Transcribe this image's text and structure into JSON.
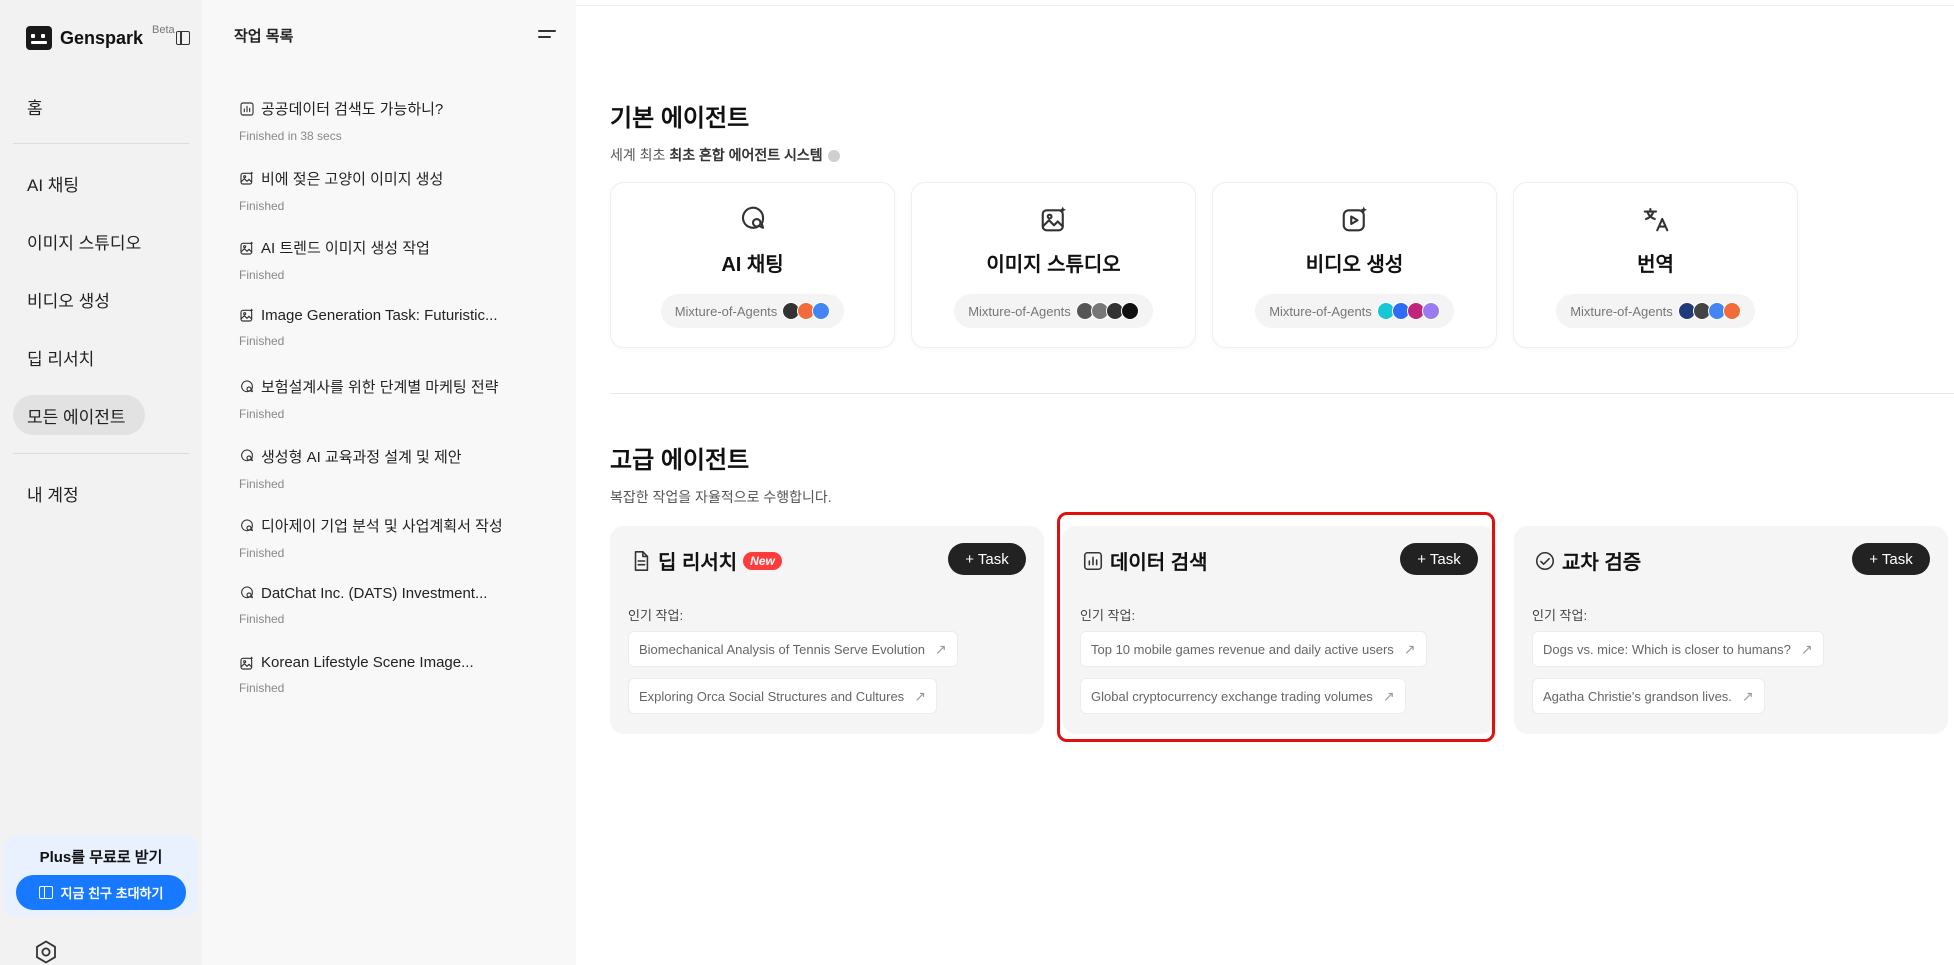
{
  "sidebar": {
    "brand": "Genspark",
    "beta": "Beta",
    "nav": [
      "홈",
      "AI 채팅",
      "이미지 스튜디오",
      "비디오 생성",
      "딥 리서치",
      "모든 에이전트",
      "내 계정"
    ],
    "promo_title": "Plus를 무료로 받기",
    "promo_button": "지금 친구 초대하기"
  },
  "tasks": {
    "title": "작업 목록",
    "items": [
      {
        "title": "공공데이터 검색도 가능하니?",
        "status": "Finished in 38 secs",
        "icon": "data-chart-icon"
      },
      {
        "title": "비에 젖은 고양이 이미지 생성",
        "status": "Finished",
        "icon": "image-icon"
      },
      {
        "title": "AI 트렌드 이미지 생성 작업",
        "status": "Finished",
        "icon": "image-icon"
      },
      {
        "title": "Image Generation Task: Futuristic...",
        "status": "Finished",
        "icon": "image-icon"
      },
      {
        "title": "보험설계사를 위한 단계별 마케팅 전략",
        "status": "Finished",
        "icon": "chat-icon"
      },
      {
        "title": "생성형 AI 교육과정 설계 및 제안",
        "status": "Finished",
        "icon": "chat-icon"
      },
      {
        "title": "디아제이 기업 분석 및 사업계획서 작성",
        "status": "Finished",
        "icon": "chat-icon"
      },
      {
        "title": "DatChat Inc. (DATS) Investment...",
        "status": "Finished",
        "icon": "chat-icon"
      },
      {
        "title": "Korean Lifestyle Scene Image...",
        "status": "Finished",
        "icon": "image-icon"
      }
    ]
  },
  "basic": {
    "title": "기본 에이전트",
    "subtitle_prefix": "세계 최초 ",
    "subtitle_bold": "최초 혼합 에어전트 시스템",
    "cards": [
      {
        "name": "AI 채팅",
        "pill": "Mixture-of-Agents",
        "icon": "chat-icon",
        "dots": [
          "#333333",
          "#f26b3a",
          "#4285f4"
        ]
      },
      {
        "name": "이미지 스튜디오",
        "pill": "Mixture-of-Agents",
        "icon": "image-icon",
        "dots": [
          "#555555",
          "#777777",
          "#333333",
          "#111111"
        ]
      },
      {
        "name": "비디오 생성",
        "pill": "Mixture-of-Agents",
        "icon": "video-icon",
        "dots": [
          "#18c6d6",
          "#2d6cf6",
          "#c0257a",
          "#9b7bf0"
        ]
      },
      {
        "name": "번역",
        "pill": "Mixture-of-Agents",
        "icon": "translate-icon",
        "dots": [
          "#1f3b7a",
          "#444444",
          "#4285f4",
          "#f26b3a"
        ]
      }
    ]
  },
  "advanced": {
    "title": "고급 에이전트",
    "subtitle": "복잡한 작업을 자율적으로 수행합니다.",
    "task_button": "+ Task",
    "popular_label": "인기 작업:",
    "new_badge": "New",
    "cards": [
      {
        "name": "딥 리서치",
        "icon": "document-icon",
        "new": true,
        "chips": [
          "Biomechanical Analysis of Tennis Serve Evolution",
          "Exploring Orca Social Structures and Cultures"
        ]
      },
      {
        "name": "데이터 검색",
        "icon": "data-chart-icon",
        "new": false,
        "chips": [
          "Top 10 mobile games revenue and daily active users",
          "Global cryptocurrency exchange trading volumes"
        ]
      },
      {
        "name": "교차 검증",
        "icon": "check-circle-icon",
        "new": false,
        "chips": [
          "Dogs vs. mice: Which is closer to humans?",
          "Agatha Christie's grandson lives."
        ]
      }
    ]
  },
  "colors": {
    "accent": "#1779ff",
    "highlight": "#e01010",
    "new_badge": "#ff3b3b"
  }
}
